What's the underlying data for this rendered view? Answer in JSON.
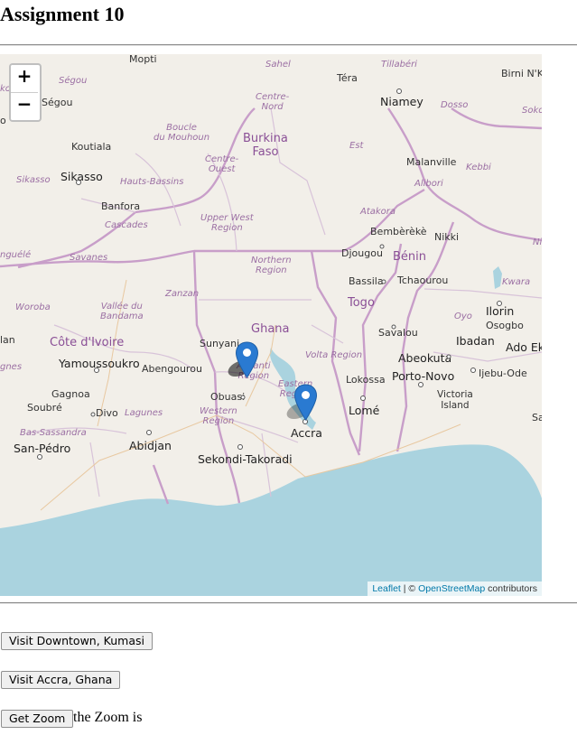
{
  "page": {
    "title": "Assignment 10"
  },
  "map": {
    "zoom_in_label": "+",
    "zoom_out_label": "−",
    "attribution": {
      "leaflet": "Leaflet",
      "separator": " | © ",
      "osm": "OpenStreetMap",
      "suffix": " contributors"
    },
    "labels": {
      "mopti": "Mopti",
      "segou_region": "Ségou",
      "segou": "Ségou",
      "sahel": "Sahel",
      "tillaberi": "Tillabéri",
      "tera": "Téra",
      "birni": "Birni N'Ko",
      "niamey": "Niamey",
      "dosso": "Dosso",
      "soko": "Soko",
      "centre_nord": "Centre-\nNord",
      "boucle": "Boucle\ndu Mouhoun",
      "burkina": "Burkina\nFaso",
      "koutiala": "Koutiala",
      "est": "Est",
      "malanville": "Malanville",
      "kebbi": "Kebbi",
      "centre_ouest": "Centre-\nOuest",
      "sikasso_region": "Sikasso",
      "sikasso": "Sikasso",
      "hauts_bassins": "Hauts-Bassins",
      "alibori": "Alibori",
      "banfora": "Banfora",
      "cascades": "Cascades",
      "upper_west": "Upper West\nRegion",
      "atakora": "Atakora",
      "bembereke": "Bembèrèkè",
      "nikki": "Nikki",
      "djougou": "Djougou",
      "benin": "Bénin",
      "savanes": "Savanes",
      "northern": "Northern\nRegion",
      "bassila": "Bassila",
      "tchaourou": "Tchaourou",
      "kwara": "Kwara",
      "zanzan": "Zanzan",
      "woroba": "Woroba",
      "vallee": "Vallée du\nBandama",
      "togo": "Togo",
      "ilorin": "Ilorin",
      "oyo": "Oyo",
      "osogbo": "Osogbo",
      "ghana": "Ghana",
      "savalou": "Savalou",
      "sunyani": "Sunyani",
      "cote": "Côte d'Ivoire",
      "ibadan": "Ibadan",
      "ado": "Ado Ek",
      "yamoussoukro": "Yamoussoukro",
      "abengourou": "Abengourou",
      "volta": "Volta Region",
      "abeokuta": "Abeokuta",
      "ashanti": "Ashanti\nRegion",
      "porto_novo": "Porto-Novo",
      "ijebu": "Ijebu-Ode",
      "lokossa": "Lokossa",
      "gagnoa": "Gagnoa",
      "obuasi": "Obuasi",
      "eastern": "Eastern\nRegion",
      "victoria": "Victoria\nIsland",
      "soubre": "Soubré",
      "divo": "Divo",
      "lagunes": "Lagunes",
      "western": "Western\nRegion",
      "lome": "Lomé",
      "bas_sassandra": "Bas-Sassandra",
      "accra": "Accra",
      "abidjan": "Abidjan",
      "san_pedro": "San-Pédro",
      "sekondi": "Sekondi-Takoradi",
      "left_ko": "ko",
      "left_o": "o",
      "left_nguele": "nguélé",
      "left_gnes": "gnes",
      "left_lan": "lan",
      "ni": "Ni",
      "sa": "Sa"
    },
    "markers": [
      {
        "name": "Downtown, Kumasi",
        "color": "#2a7ad1"
      },
      {
        "name": "Accra, Ghana",
        "color": "#2a7ad1"
      }
    ],
    "colors": {
      "sea": "#aad3df",
      "land": "#f2efe9",
      "border": "#c89ec9"
    }
  },
  "buttons": {
    "kumasi": "Visit Downtown, Kumasi",
    "accra": "Visit Accra, Ghana",
    "get_zoom": "Get Zoom"
  },
  "zoom_text": "the Zoom is"
}
